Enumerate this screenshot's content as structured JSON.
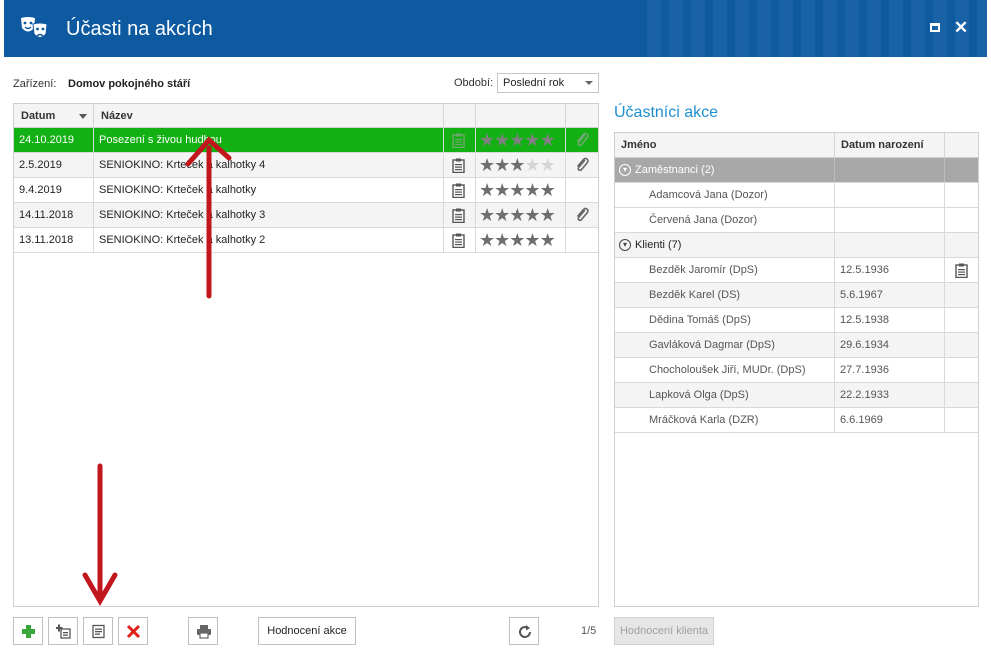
{
  "window": {
    "title": "Účasti na akcích",
    "maximize_label": "maximize",
    "close_label": "✕"
  },
  "filters": {
    "facility_label": "Zařízení:",
    "facility_value": "Domov pokojného stáří",
    "period_label": "Období:",
    "period_value": "Poslední rok"
  },
  "events": {
    "columns": {
      "date": "Datum",
      "name": "Název"
    },
    "rows": [
      {
        "date": "24.10.2019",
        "name": "Posezení s živou hudbou",
        "rating": 5,
        "attachment": true,
        "selected": true
      },
      {
        "date": "2.5.2019",
        "name": "SENIOKINO: Krteček a kalhotky 4",
        "rating": 3,
        "attachment": true
      },
      {
        "date": "9.4.2019",
        "name": "SENIOKINO: Krteček a kalhotky",
        "rating": 5,
        "attachment": false
      },
      {
        "date": "14.11.2018",
        "name": "SENIOKINO: Krteček a kalhotky 3",
        "rating": 5,
        "attachment": true
      },
      {
        "date": "13.11.2018",
        "name": "SENIOKINO: Krteček a kalhotky 2",
        "rating": 5,
        "attachment": false
      }
    ]
  },
  "participants": {
    "title": "Účastníci akce",
    "columns": {
      "name": "Jméno",
      "birth": "Datum narození"
    },
    "groups": [
      {
        "label": "Zaměstnanci (2)",
        "members": [
          {
            "name": "Adamcová Jana (Dozor)",
            "birth": ""
          },
          {
            "name": "Červená Jana (Dozor)",
            "birth": ""
          }
        ]
      },
      {
        "label": "Klienti (7)",
        "members": [
          {
            "name": "Bezděk Jaromír (DpS)",
            "birth": "12.5.1936",
            "note": true
          },
          {
            "name": "Bezděk Karel (DS)",
            "birth": "5.6.1967"
          },
          {
            "name": "Dědina Tomáš (DpS)",
            "birth": "12.5.1938"
          },
          {
            "name": "Gavláková Dagmar (DpS)",
            "birth": "29.6.1934"
          },
          {
            "name": "Chocholoušek Jiří, MUDr. (DpS)",
            "birth": "27.7.1936"
          },
          {
            "name": "Lapková Olga (DpS)",
            "birth": "22.2.1933"
          },
          {
            "name": "Mráčková Karla (DZR)",
            "birth": "6.6.1969"
          }
        ]
      }
    ]
  },
  "toolbar": {
    "rate_event_label": "Hodnocení akce",
    "page_counter": "1/5",
    "rate_client_label": "Hodnocení klienta"
  },
  "colors": {
    "titlebar": "#0e5aa1",
    "selected_row": "#12b012",
    "accent_title": "#1e8fd0",
    "annotation_arrow": "#c0161c"
  }
}
